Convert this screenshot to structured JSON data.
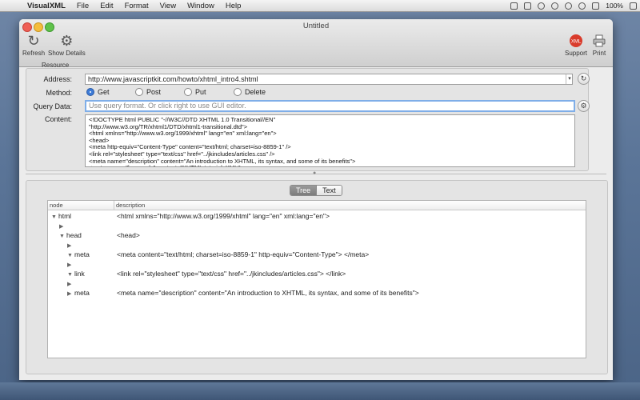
{
  "menubar": {
    "app_name": "VisualXML",
    "items": [
      "File",
      "Edit",
      "Format",
      "View",
      "Window",
      "Help"
    ],
    "battery": "100%"
  },
  "window": {
    "title": "Untitled",
    "toolbar": {
      "refresh_label": "Refresh",
      "show_details_label": "Show Details",
      "support_label": "Support",
      "print_label": "Print"
    }
  },
  "resource": {
    "section_label": "Resource",
    "address_label": "Address:",
    "address_value": "http://www.javascriptkit.com/howto/xhtml_intro4.shtml",
    "method_label": "Method:",
    "methods": [
      "Get",
      "Post",
      "Put",
      "Delete"
    ],
    "selected_method": "Get",
    "query_label": "Query Data:",
    "query_placeholder": "Use query format. Or click right to use GUI editor.",
    "content_label": "Content:",
    "content_text": "<!DOCTYPE html PUBLIC \"-//W3C//DTD XHTML 1.0 Transitional//EN\"\n\"http://www.w3.org/TR/xhtml1/DTD/xhtml1-transitional.dtd\">\n<html xmlns=\"http://www.w3.org/1999/xhtml\" lang=\"en\" xml:lang=\"en\">\n<head>\n<meta http-equiv=\"Content-Type\" content=\"text/html; charset=iso-8859-1\" />\n<link rel=\"stylesheet\" type=\"text/css\" href=\"../jkincludes/articles.css\" />\n<meta name=\"description\" content=\"An introduction to XHTML, its syntax, and some of its benefits\">\n<meta name=\"keywords\" content=\"XHTML tutorial, XML\">"
  },
  "view_toggle": {
    "tree_label": "Tree",
    "text_label": "Text",
    "active": "Tree"
  },
  "tree": {
    "columns": [
      "node",
      "description"
    ],
    "rows": [
      {
        "node": "html",
        "desc": "<html xmlns=\"http://www.w3.org/1999/xhtml\" lang=\"en\" xml:lang=\"en\">",
        "expanded": true
      },
      {
        "node": "",
        "desc": "",
        "expanded": false
      },
      {
        "node": "head",
        "desc": "<head>",
        "expanded": true
      },
      {
        "node": "",
        "desc": "",
        "expanded": false
      },
      {
        "node": "meta",
        "desc": "<meta content=\"text/html; charset=iso-8859-1\" http-equiv=\"Content-Type\"> </meta>",
        "expanded": true
      },
      {
        "node": "",
        "desc": "",
        "expanded": false
      },
      {
        "node": "link",
        "desc": "<link rel=\"stylesheet\" type=\"text/css\" href=\"../jkincludes/articles.css\"> </link>",
        "expanded": true
      },
      {
        "node": "",
        "desc": "",
        "expanded": false
      },
      {
        "node": "meta",
        "desc": "<meta name=\"description\" content=\"An introduction to XHTML, its syntax, and some of its benefits\">",
        "expanded": false
      }
    ]
  }
}
